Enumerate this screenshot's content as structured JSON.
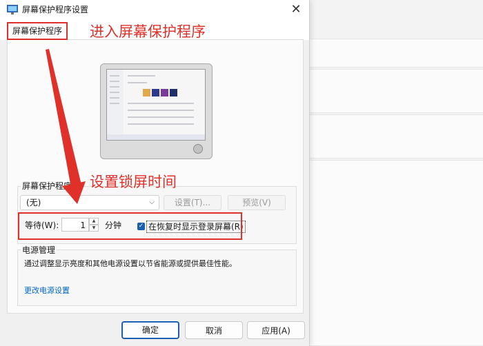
{
  "window": {
    "title": "屏幕保护程序设置",
    "close_symbol": "✕"
  },
  "tab": {
    "label": "屏幕保护程序"
  },
  "screensaver_group": {
    "label": "屏幕保护程序(",
    "selected_value": "(无)",
    "settings_button": "设置(T)...",
    "preview_button": "预览(V)"
  },
  "wait": {
    "label": "等待(W):",
    "value": "1",
    "unit": "分钟"
  },
  "resume_checkbox": {
    "label": "在恢复时显示登录屏幕(R)",
    "checked": true
  },
  "power_group": {
    "label": "电源管理",
    "description": "通过调整显示亮度和其他电源设置以节省能源或提供最佳性能。",
    "link": "更改电源设置"
  },
  "buttons": {
    "ok": "确定",
    "cancel": "取消",
    "apply": "应用(A)"
  },
  "annotations": {
    "enter_screensaver": "进入屏幕保护程序",
    "set_lock_time": "设置锁屏时间"
  },
  "colors": {
    "annotation_red": "#e0302a",
    "accent_blue": "#1a5fb4",
    "link_blue": "#0066cc"
  }
}
